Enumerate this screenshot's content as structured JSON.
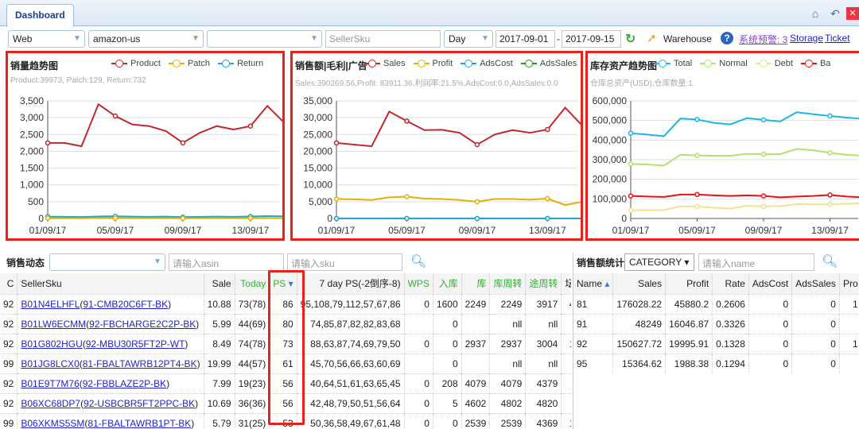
{
  "tab": {
    "label": "Dashboard"
  },
  "window_icons": {
    "home": "home-icon",
    "back": "back-icon",
    "close": "close-icon"
  },
  "toolbar": {
    "platform": "Web",
    "site": "amazon-us",
    "third": "",
    "sku_placeholder": "SellerSku",
    "period": "Day",
    "date_from": "2017-09-01",
    "date_sep": "-",
    "date_to": "2017-09-15",
    "warehouse": "Warehouse",
    "alert": "系统预警: 3",
    "storage": "Storage",
    "ticket": "Ticket"
  },
  "panels": [
    {
      "title": "销量趋势图",
      "subtitle": "Product:39973, Patch:129, Return:732",
      "legend": [
        "Product",
        "Patch",
        "Return"
      ]
    },
    {
      "title": "销售额|毛利|广告",
      "subtitle": "Sales:390269.56,Profit: 83911.36,利润率:21.5%,AdsCost:0.0,AdsSales:0.0",
      "legend": [
        "Sales",
        "Profit",
        "AdsCost",
        "AdsSales"
      ]
    },
    {
      "title": "库存资产趋势图",
      "subtitle": "仓库总资产(USD),仓库数量:1",
      "legend": [
        "Total",
        "Normal",
        "Debt",
        "Ba"
      ]
    }
  ],
  "chart_data": [
    {
      "type": "line",
      "title": "销量趋势图",
      "x": [
        "01/09/17",
        "02/09/17",
        "03/09/17",
        "04/09/17",
        "05/09/17",
        "06/09/17",
        "07/09/17",
        "08/09/17",
        "09/09/17",
        "10/09/17",
        "11/09/17",
        "12/09/17",
        "13/09/17",
        "14/09/17",
        "15/09/17"
      ],
      "xticks": [
        "01/09/17",
        "05/09/17",
        "09/09/17",
        "13/09/17"
      ],
      "ylim": [
        0,
        3500
      ],
      "yticks": [
        "0",
        "500",
        "1,000",
        "1,500",
        "2,000",
        "2,500",
        "3,000",
        "3,500"
      ],
      "series": [
        {
          "name": "Product",
          "color": "#c0282d",
          "values": [
            2250,
            2250,
            2150,
            3400,
            3050,
            2800,
            2750,
            2600,
            2250,
            2550,
            2750,
            2650,
            2750,
            3350,
            2850
          ]
        },
        {
          "name": "Patch",
          "color": "#e2b000",
          "values": [
            10,
            10,
            5,
            15,
            10,
            8,
            8,
            10,
            5,
            10,
            10,
            8,
            10,
            12,
            10
          ]
        },
        {
          "name": "Return",
          "color": "#22a3d6",
          "values": [
            55,
            50,
            45,
            60,
            65,
            55,
            50,
            55,
            40,
            50,
            55,
            50,
            60,
            70,
            65
          ]
        }
      ]
    },
    {
      "type": "line",
      "title": "销售额|毛利|广告",
      "x": [
        "01/09/17",
        "02/09/17",
        "03/09/17",
        "04/09/17",
        "05/09/17",
        "06/09/17",
        "07/09/17",
        "08/09/17",
        "09/09/17",
        "10/09/17",
        "11/09/17",
        "12/09/17",
        "13/09/17",
        "14/09/17",
        "15/09/17"
      ],
      "xticks": [
        "01/09/17",
        "05/09/17",
        "09/09/17",
        "13/09/17"
      ],
      "ylim": [
        0,
        35000
      ],
      "yticks": [
        "0",
        "5,000",
        "10,000",
        "15,000",
        "20,000",
        "25,000",
        "30,000",
        "35,000"
      ],
      "series": [
        {
          "name": "Sales",
          "color": "#c0282d",
          "values": [
            22500,
            22000,
            21500,
            31800,
            29000,
            26300,
            26400,
            25500,
            22000,
            25000,
            26300,
            25500,
            26500,
            33000,
            27500
          ]
        },
        {
          "name": "Profit",
          "color": "#e2b000",
          "values": [
            5800,
            5700,
            5500,
            6300,
            6500,
            5900,
            5800,
            5500,
            5000,
            5800,
            5800,
            5600,
            5900,
            4000,
            5000
          ]
        },
        {
          "name": "AdsCost",
          "color": "#22a3d6",
          "values": [
            0,
            0,
            0,
            0,
            0,
            0,
            0,
            0,
            0,
            0,
            0,
            0,
            0,
            0,
            0
          ]
        },
        {
          "name": "AdsSales",
          "color": "#2e8b2e",
          "values": [
            0,
            0,
            0,
            0,
            0,
            0,
            0,
            0,
            0,
            0,
            0,
            0,
            0,
            0,
            0
          ]
        }
      ]
    },
    {
      "type": "line",
      "title": "库存资产趋势图",
      "x": [
        "01/09/17",
        "02/09/17",
        "03/09/17",
        "04/09/17",
        "05/09/17",
        "06/09/17",
        "07/09/17",
        "08/09/17",
        "09/09/17",
        "10/09/17",
        "11/09/17",
        "12/09/17",
        "13/09/17",
        "14/09/17",
        "15/09/17"
      ],
      "xticks": [
        "01/09/17",
        "05/09/17",
        "09/09/17",
        "13/09/17"
      ],
      "ylim": [
        0,
        600000
      ],
      "yticks": [
        "0",
        "100,000",
        "200,000",
        "300,000",
        "400,000",
        "500,000",
        "600,000"
      ],
      "series": [
        {
          "name": "Total",
          "color": "#1eb4ea",
          "values": [
            435000,
            428000,
            420000,
            510000,
            505000,
            488000,
            480000,
            512000,
            503000,
            495000,
            542000,
            532000,
            523000,
            515000,
            508000
          ]
        },
        {
          "name": "Normal",
          "color": "#b5e06a",
          "values": [
            278000,
            275000,
            270000,
            325000,
            322000,
            320000,
            320000,
            330000,
            328000,
            328000,
            355000,
            348000,
            335000,
            325000,
            320000
          ]
        },
        {
          "name": "Debt",
          "color": "#ece38c",
          "values": [
            42000,
            42000,
            43000,
            62000,
            62000,
            55000,
            50000,
            65000,
            62000,
            63000,
            73000,
            72000,
            72000,
            75000,
            78000
          ]
        },
        {
          "name": "Ba",
          "color": "#e8121b",
          "values": [
            115000,
            112000,
            110000,
            122000,
            122000,
            118000,
            115000,
            118000,
            115000,
            108000,
            112000,
            115000,
            120000,
            112000,
            108000
          ]
        }
      ]
    }
  ],
  "sales": {
    "title": "销售动态",
    "asin_placeholder": "请输入asin",
    "sku_placeholder": "请输入sku",
    "columns": [
      "C",
      "SellerSku",
      "Sale",
      "Today",
      "PS",
      "7 day PS(-2倒序-8)",
      "WPS",
      "入库",
      "库",
      "库周转",
      "途周转",
      "坛"
    ],
    "rows": [
      [
        "92",
        "B01N4ELHFL",
        "91-CMB20C6FT-BK",
        "10.88",
        "73(78)",
        "86",
        "95,108,79,112,57,67,86",
        "0",
        "1600",
        "2249",
        "2249",
        "3917",
        "4"
      ],
      [
        "92",
        "B01LW6ECMM",
        "92-FBCHARGE2C2P-BK",
        "5.99",
        "44(69)",
        "80",
        "74,85,87,82,82,83,68",
        "",
        "0",
        "",
        "nll",
        "nll",
        ""
      ],
      [
        "92",
        "B01G802HGU",
        "92-MBU30R5FT2P-WT",
        "8.49",
        "74(78)",
        "73",
        "88,63,87,74,69,79,50",
        "0",
        "0",
        "2937",
        "2937",
        "3004",
        "1"
      ],
      [
        "99",
        "B01JG8LCX0",
        "81-FBALTAWRB12PT4-BK",
        "19.99",
        "44(57)",
        "61",
        "45,70,56,66,63,60,69",
        "",
        "0",
        "",
        "nll",
        "nll",
        ""
      ],
      [
        "92",
        "B01E9T7M76",
        "92-FBBLAZE2P-BK",
        "7.99",
        "19(23)",
        "56",
        "40,64,51,61,63,65,45",
        "0",
        "208",
        "4079",
        "4079",
        "4379",
        ""
      ],
      [
        "92",
        "B06XC68DP7",
        "92-USBCBR5FT2PPC-BK",
        "10.69",
        "36(36)",
        "56",
        "42,48,79,50,51,56,64",
        "0",
        "5",
        "4602",
        "4802",
        "4820",
        ""
      ],
      [
        "99",
        "B06XKMS5SM",
        "81-FBALTAWRB1PT-BK",
        "5.79",
        "31(25)",
        "53",
        "50,36,58,49,67,61,48",
        "0",
        "0",
        "2539",
        "2539",
        "4369",
        "1"
      ]
    ]
  },
  "stats": {
    "title": "销售额统计",
    "category": "CATEGORY",
    "name_placeholder": "请输入name",
    "columns": [
      "Name",
      "Sales",
      "Profit",
      "Rate",
      "AdsCost",
      "AdsSales",
      "Pro"
    ],
    "rows": [
      [
        "81",
        "176028.22",
        "45880.2",
        "0.2606",
        "0",
        "0",
        "1"
      ],
      [
        "91",
        "48249",
        "16046.87",
        "0.3326",
        "0",
        "0",
        ""
      ],
      [
        "92",
        "150627.72",
        "19995.91",
        "0.1328",
        "0",
        "0",
        "1"
      ],
      [
        "95",
        "15364.62",
        "1988.38",
        "0.1294",
        "0",
        "0",
        ""
      ]
    ]
  }
}
